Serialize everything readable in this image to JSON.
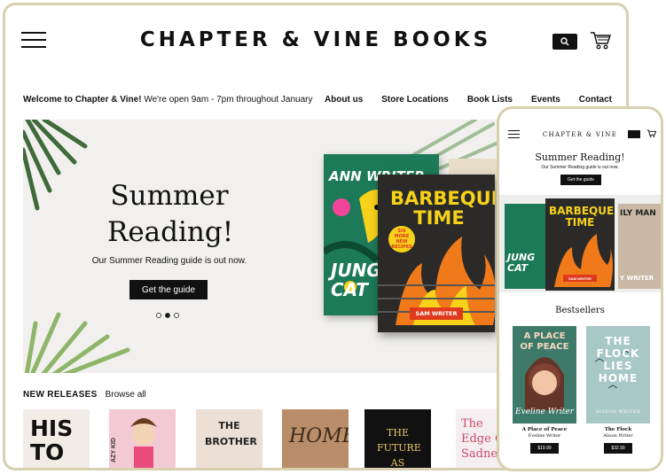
{
  "header": {
    "brand": "CHAPTER & VINE BOOKS"
  },
  "infobar": {
    "welcome_bold": "Welcome to Chapter & Vine!",
    "welcome_rest": " We're open 9am - 7pm throughout January"
  },
  "nav": [
    "About us",
    "Store Locations",
    "Book Lists",
    "Events",
    "Contact"
  ],
  "hero": {
    "title_line1": "Summer",
    "title_line2": "Reading!",
    "subtitle": "Our Summer Reading guide is out now.",
    "button": "Get the guide",
    "slide": 2,
    "slides": 3
  },
  "hero_books": [
    {
      "title": "ANN WRITER",
      "subtitle": "JUNG CAT"
    },
    {
      "title": "BARBEQUE TIME",
      "badge": "SIX MORE NEW RECIPES",
      "author": "SAM WRITER"
    }
  ],
  "new_releases": {
    "title": "NEW RELEASES",
    "browse": "Browse all",
    "covers": [
      "HIS TO",
      "AZY KID",
      "THE BROTHER",
      "HOME",
      "THE FUTURE AS",
      "The Edge C Sadnes"
    ]
  },
  "phone": {
    "brand": "CHAPTER & VINE",
    "hero_title": "Summer Reading!",
    "hero_sub": "Our Summer Reading guide is out now.",
    "button": "Get the guide",
    "hero_books": [
      "JUNG CAT",
      "BARBEQUE TIME",
      "SAM WRITER",
      "ILY MAN",
      "Y WRITER"
    ],
    "bestsellers_title": "Bestsellers",
    "bestsellers": [
      {
        "cover_title": "A PLACE OF PEACE",
        "cover_author": "Eveline Writer",
        "title": "A Place of Peace",
        "author": "Eveline Writer",
        "price": "$19.99"
      },
      {
        "cover_title": "THE FLOCK LIES HOME",
        "cover_author": "ALISON WRITER",
        "title": "The Flock",
        "author": "Alison Writer",
        "price": "$32.99"
      }
    ]
  },
  "colors": {
    "frame": "#d8cfae",
    "ink": "#111111",
    "accent_yellow": "#f7d21a",
    "grill_red": "#e03a1e"
  }
}
